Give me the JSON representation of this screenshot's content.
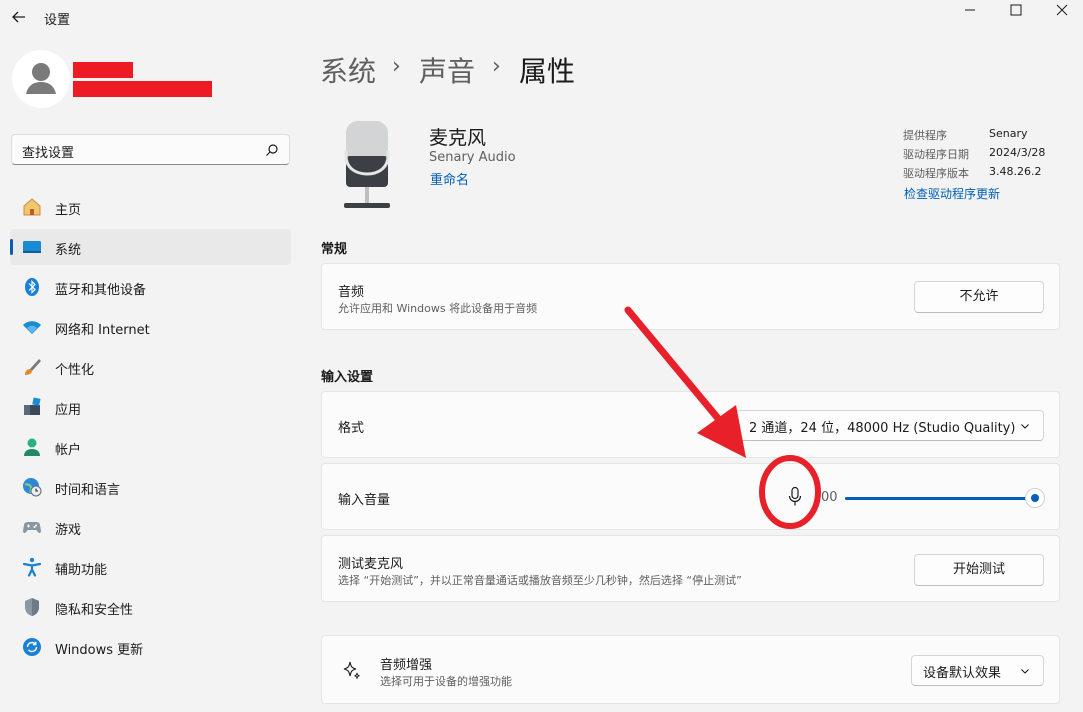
{
  "app": {
    "title": "设置"
  },
  "search": {
    "placeholder": "查找设置"
  },
  "nav": [
    {
      "id": "home",
      "label": "主页",
      "icon": "home-icon"
    },
    {
      "id": "system",
      "label": "系统",
      "icon": "monitor-icon",
      "active": true
    },
    {
      "id": "bluetooth",
      "label": "蓝牙和其他设备",
      "icon": "bluetooth-icon"
    },
    {
      "id": "network",
      "label": "网络和 Internet",
      "icon": "wifi-icon"
    },
    {
      "id": "personalize",
      "label": "个性化",
      "icon": "brush-icon"
    },
    {
      "id": "apps",
      "label": "应用",
      "icon": "apps-icon"
    },
    {
      "id": "accounts",
      "label": "帐户",
      "icon": "account-icon"
    },
    {
      "id": "time",
      "label": "时间和语言",
      "icon": "globe-clock-icon"
    },
    {
      "id": "gaming",
      "label": "游戏",
      "icon": "gamepad-icon"
    },
    {
      "id": "accessibility",
      "label": "辅助功能",
      "icon": "accessibility-icon"
    },
    {
      "id": "privacy",
      "label": "隐私和安全性",
      "icon": "shield-icon"
    },
    {
      "id": "update",
      "label": "Windows 更新",
      "icon": "update-icon"
    }
  ],
  "breadcrumb": {
    "items": [
      "系统",
      "声音",
      "属性"
    ],
    "separator": "›"
  },
  "device": {
    "name": "麦克风",
    "vendor": "Senary Audio",
    "rename": "重命名",
    "info": [
      {
        "label": "提供程序",
        "value": "Senary"
      },
      {
        "label": "驱动程序日期",
        "value": "2024/3/28"
      },
      {
        "label": "驱动程序版本",
        "value": "3.48.26.2"
      }
    ],
    "check_driver": "检查驱动程序更新"
  },
  "general": {
    "title": "常规",
    "audio": {
      "title": "音频",
      "subtitle": "允许应用和 Windows 将此设备用于音频",
      "button": "不允许"
    }
  },
  "input": {
    "title": "输入设置",
    "format": {
      "title": "格式",
      "value": "2 通道，24 位，48000 Hz (Studio Quality)"
    },
    "volume": {
      "title": "输入音量",
      "value_text": "00",
      "level": 1.0
    },
    "test": {
      "title": "测试麦克风",
      "subtitle": "选择 “开始测试”，并以正常音量通话或播放音频至少几秒钟，然后选择 “停止测试”",
      "button": "开始测试"
    }
  },
  "enhance": {
    "title": "音频增强",
    "subtitle": "选择可用于设备的增强功能",
    "value": "设备默认效果"
  },
  "colors": {
    "accent": "#005fb8",
    "annotation": "#e8202a",
    "redaction": "#ed1c24"
  }
}
